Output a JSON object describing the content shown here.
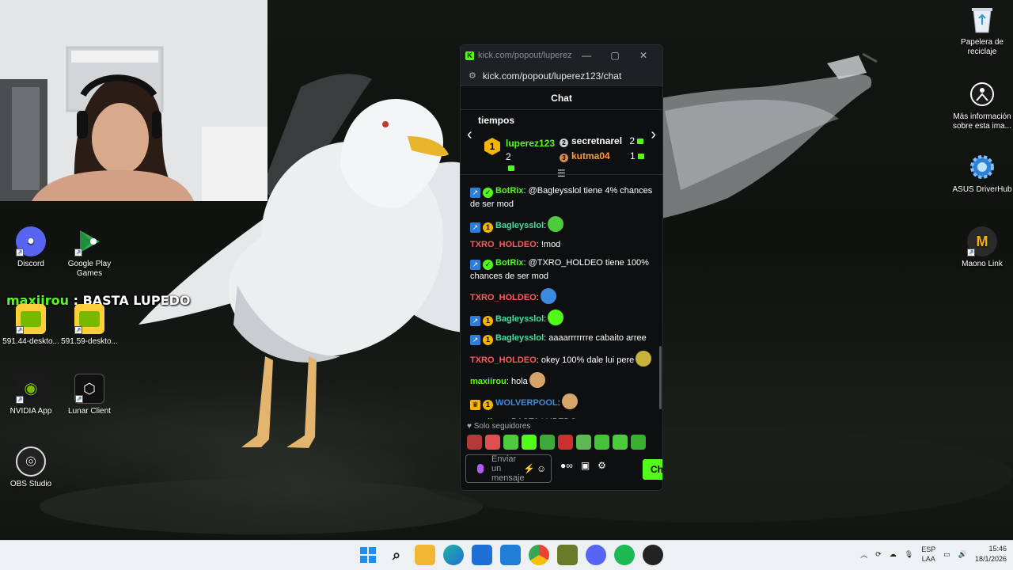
{
  "overlay": {
    "user": "maxiirou",
    "separator": " : ",
    "text": "BASTA LUPEDO"
  },
  "desktop_icons": {
    "discord": "Discord",
    "google_play": "Google Play Games",
    "nvidia1": "591.44-deskto...",
    "nvidia2": "591.59-deskto...",
    "nvidia_app": "NVIDIA App",
    "lunar": "Lunar Client",
    "obs": "OBS Studio",
    "recycle": "Papelera de reciclaje",
    "info": "Más información sobre esta ima...",
    "asus": "ASUS DriverHub",
    "maono": "Maono Link"
  },
  "window": {
    "title": "kick.com/popout/luperez12...",
    "url": "kick.com/popout/luperez123/chat",
    "header": "Chat",
    "minimize": "—",
    "maximize": "▢",
    "close": "✕"
  },
  "leaderboard": {
    "label": "tiempos",
    "first": {
      "rank": "1",
      "name": "luperez123",
      "count": "2"
    },
    "second": {
      "rank": "2",
      "name": "secretnarel",
      "count": "2"
    },
    "third": {
      "rank": "3",
      "name": "kutma04",
      "count": "1"
    }
  },
  "messages": [
    {
      "user": "BotRix",
      "color": "#53fc18",
      "badges": [
        "bot",
        "verified"
      ],
      "text": ": @Bagleysslol tiene 4% chances de ser mod"
    },
    {
      "user": "Bagleysslol",
      "color": "#3ee0a0",
      "badges": [
        "bot",
        "sub"
      ],
      "text": ":",
      "emote": "#4ecb3c"
    },
    {
      "user": "TXRO_HOLDEO",
      "color": "#ff5a5a",
      "badges": [],
      "text": ": !mod"
    },
    {
      "user": "BotRix",
      "color": "#53fc18",
      "badges": [
        "bot",
        "verified"
      ],
      "text": ": @TXRO_HOLDEO tiene 100% chances de ser mod"
    },
    {
      "user": "TXRO_HOLDEO",
      "color": "#ff5a5a",
      "badges": [],
      "text": ":",
      "emote": "#3c8be0"
    },
    {
      "user": "Bagleysslol",
      "color": "#3ee0a0",
      "badges": [
        "bot",
        "sub"
      ],
      "text": ":",
      "emote": "#53fc18"
    },
    {
      "user": "Bagleysslol",
      "color": "#3ee0a0",
      "badges": [
        "bot",
        "sub"
      ],
      "text": ": aaaarrrrrrre cabaito arree"
    },
    {
      "user": "TXRO_HOLDEO",
      "color": "#ff5a5a",
      "badges": [],
      "text": ": okey 100% dale lui pere",
      "emote": "#c9b23a"
    },
    {
      "user": "maxiirou",
      "color": "#53fc18",
      "badges": [],
      "text": ": hola",
      "emote": "#d6a56a"
    },
    {
      "user": "WOLVERPOOL",
      "color": "#3c8be0",
      "badges": [
        "crown",
        "sub"
      ],
      "text": ":",
      "emote": "#d6a56a"
    },
    {
      "user": "maxiirou",
      "color": "#53fc18",
      "badges": [],
      "text": ": BASTA LUPEDO"
    }
  ],
  "bottom": {
    "mode": "Solo seguidores",
    "placeholder": "Enviar un mensaje",
    "send": "Chat"
  },
  "taskbar": {
    "lang1": "ESP",
    "lang2": "LAA",
    "time": "15:46",
    "date": "18/1/2026"
  }
}
